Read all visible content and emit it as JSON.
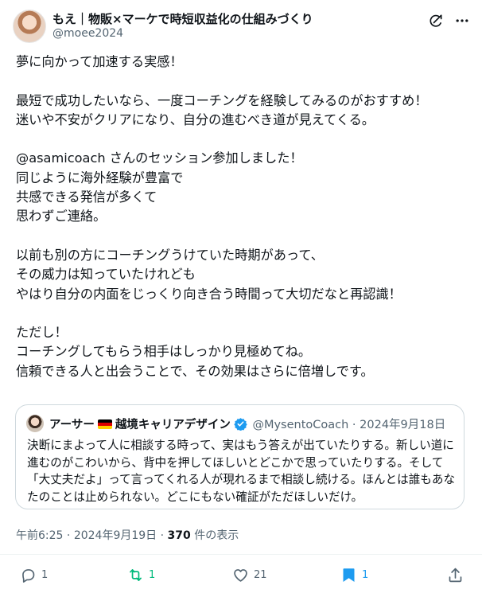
{
  "author": {
    "name": "もえ｜物販×マーケで時短収益化の仕組みづくり",
    "handle": "@moee2024"
  },
  "post": {
    "text": "夢に向かって加速する実感！\n\n最短で成功したいなら、一度コーチングを経験してみるのがおすすめ！\n迷いや不安がクリアになり、自分の進むべき道が見えてくる。\n\n@asamicoach さんのセッション参加しました！\n同じように海外経験が豊富で\n共感できる発信が多くて\n思わずご連絡。\n\n以前も別の方にコーチングうけていた時期があって、\nその威力は知っていたけれども\nやはり自分の内面をじっくり向き合う時間って大切だなと再認識！\n\nただし！\nコーチングしてもらう相手はしっかり見極めてね。\n信頼できる人と出会うことで、その効果はさらに倍増しです。"
  },
  "quote": {
    "name": "アーサー",
    "name_suffix": "越境キャリアデザイン",
    "handle": "@MysentoCoach",
    "date": "2024年9月18日",
    "text": "決断にまよって人に相談する時って、実はもう答えが出ていたりする。新しい道に進むのがこわいから、背中を押してほしいとどこかで思っていたりする。そして「大丈夫だよ」って言ってくれる人が現れるまで相談し続ける。ほんとは誰もあなたのことは止められない。どこにもない確証がただほしいだけ。"
  },
  "meta": {
    "time": "午前6:25",
    "date": "2024年9月19日",
    "views_count": "370",
    "views_label": "件の表示",
    "sep": "·"
  },
  "actions": {
    "reply_count": "1",
    "repost_count": "1",
    "like_count": "21",
    "bookmark_count": "1"
  },
  "colors": {
    "text": "#0f1419",
    "secondary": "#536471",
    "repost_active": "#00ba7c",
    "bookmark_active": "#1d9bf0",
    "verified": "#1d9bf0",
    "border": "#cfd9de"
  },
  "icons": [
    "grok-icon",
    "more-icon",
    "verified-badge-icon",
    "german-flag-icon",
    "reply-icon",
    "repost-icon",
    "like-icon",
    "bookmark-icon",
    "share-icon"
  ]
}
